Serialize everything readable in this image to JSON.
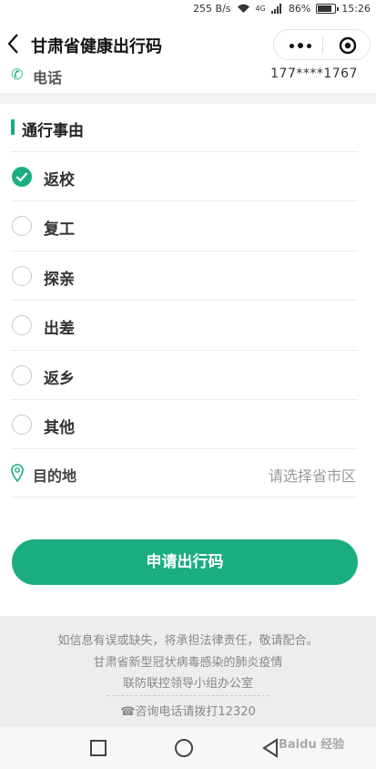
{
  "status_bar": {
    "speed": "255 B/s",
    "network": "4G",
    "battery_percent": "86%",
    "time": "15:26"
  },
  "nav": {
    "title": "甘肃省健康出行码"
  },
  "phone": {
    "label": "电话",
    "number": "177****1767"
  },
  "section": {
    "title": "通行事由"
  },
  "reasons": [
    {
      "label": "返校",
      "selected": true
    },
    {
      "label": "复工",
      "selected": false
    },
    {
      "label": "探亲",
      "selected": false
    },
    {
      "label": "出差",
      "selected": false
    },
    {
      "label": "返乡",
      "selected": false
    },
    {
      "label": "其他",
      "selected": false
    }
  ],
  "destination": {
    "label": "目的地",
    "placeholder": "请选择省市区"
  },
  "submit": {
    "label": "申请出行码"
  },
  "footer": {
    "line1": "如信息有误或缺失，将承担法律责任，敬请配合。",
    "line2": "甘肃省新型冠状病毒感染的肺炎疫情",
    "line3": "联防联控领导小组办公室",
    "hotline": "☎咨询电话请拨打12320"
  },
  "watermark": "Baidu 经验",
  "colors": {
    "accent": "#1aad82",
    "footer_bg": "#ededed"
  }
}
